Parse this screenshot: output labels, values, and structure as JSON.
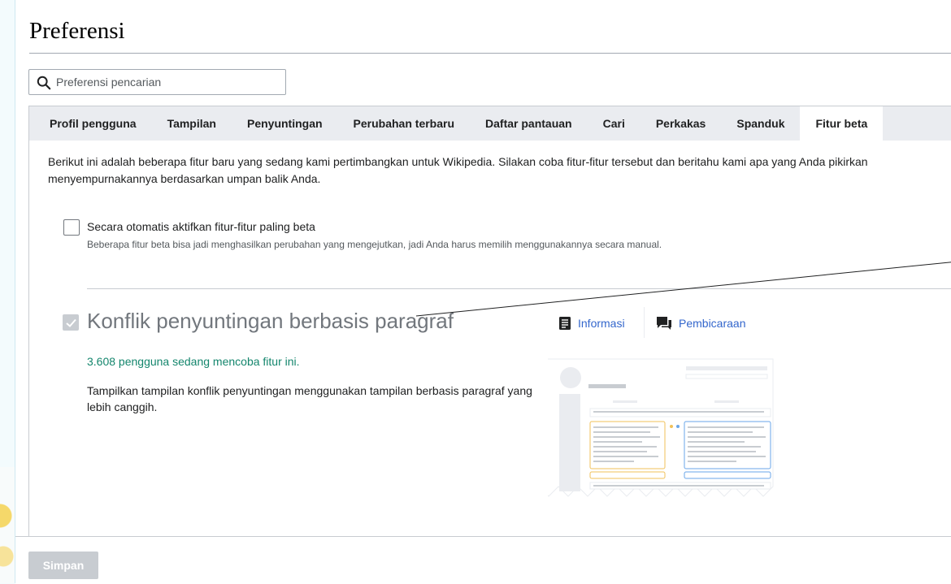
{
  "page": {
    "title": "Preferensi"
  },
  "search": {
    "placeholder": "Preferensi pencarian"
  },
  "tabs": [
    {
      "label": "Profil pengguna"
    },
    {
      "label": "Tampilan"
    },
    {
      "label": "Penyuntingan"
    },
    {
      "label": "Perubahan terbaru"
    },
    {
      "label": "Daftar pantauan"
    },
    {
      "label": "Cari"
    },
    {
      "label": "Perkakas"
    },
    {
      "label": "Spanduk"
    },
    {
      "label": "Fitur beta",
      "active": true
    }
  ],
  "beta": {
    "intro_line1": "Berikut ini adalah beberapa fitur baru yang sedang kami pertimbangkan untuk Wikipedia. Silakan coba fitur-fitur tersebut dan beritahu kami apa yang Anda pikirkan",
    "intro_line2": "menyempurnakannya berdasarkan umpan balik Anda.",
    "auto_enable_label": "Secara otomatis aktifkan fitur-fitur paling beta",
    "auto_enable_checked": false,
    "auto_enable_help": "Beberapa fitur beta bisa jadi menghasilkan perubahan yang mengejutkan, jadi Anda harus memilih menggunakannya secara manual.",
    "feature": {
      "name": "Konflik penyuntingan berbasis paragraf",
      "checked": true,
      "info_label": "Informasi",
      "info_icon": "document-icon",
      "talk_label": "Pembicaraan",
      "talk_icon": "speech-bubbles-icon",
      "user_count": "3.608 pengguna sedang mencoba fitur ini.",
      "description": "Tampilkan tampilan konflik penyuntingan menggunakan tampilan berbasis paragraf yang lebih canggih."
    }
  },
  "footer": {
    "save_label": "Simpan",
    "save_enabled": false
  },
  "colors": {
    "link": "#3366cc",
    "success": "#14866d",
    "disabled": "#c8ccd1",
    "tabbar": "#eaecf0"
  }
}
